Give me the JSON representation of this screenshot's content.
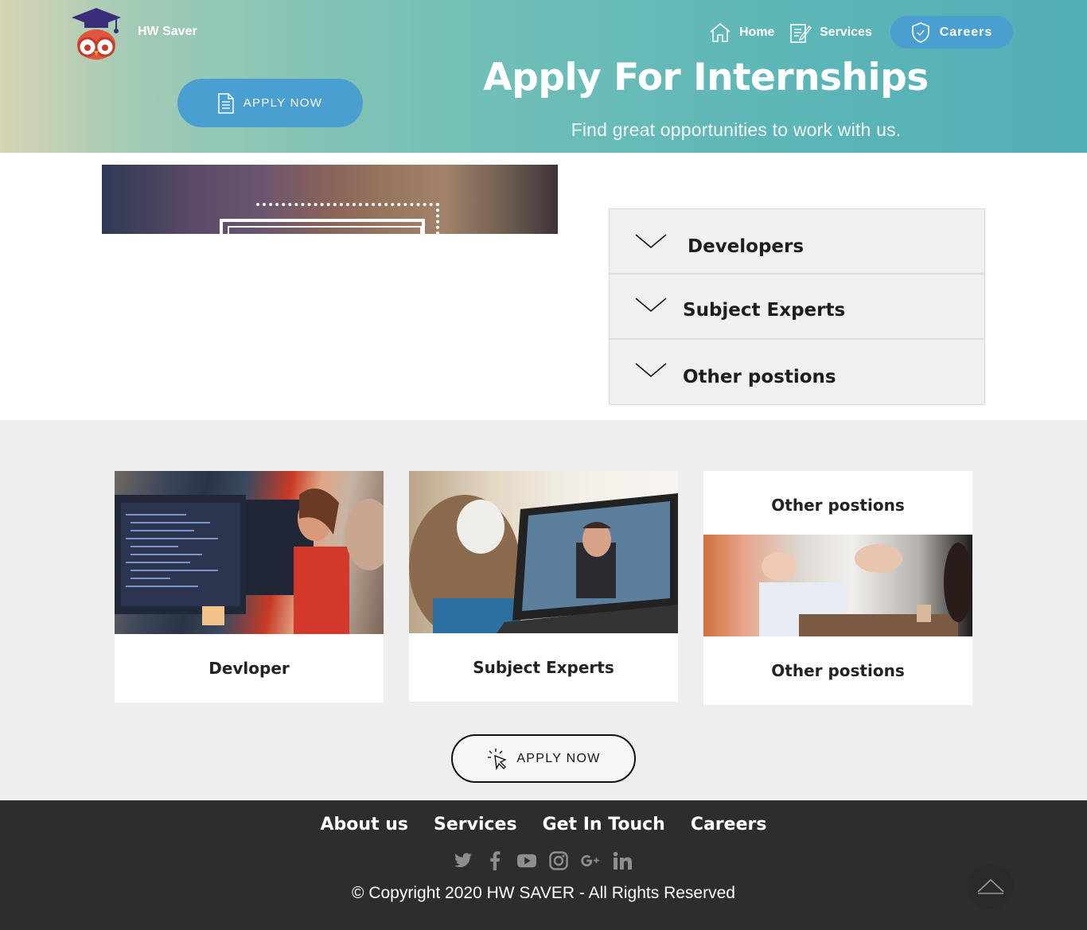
{
  "header": {
    "brand": "HW Saver",
    "nav": {
      "home": "Home",
      "services": "Services",
      "careers": "Careers"
    },
    "apply_label": "APPLY NOW",
    "title": "Apply For Internships",
    "subtitle": "Find great opportunities to work with us."
  },
  "accordion": {
    "items": [
      {
        "label": "Developers",
        "icon": "chevron-down-icon"
      },
      {
        "label": "Subject Experts",
        "icon": "chevron-down-icon"
      },
      {
        "label": "Other postions",
        "icon": "chevron-down-icon"
      }
    ]
  },
  "cards": [
    {
      "label": "Devloper"
    },
    {
      "label": "Subject Experts"
    },
    {
      "top_label": "Other postions",
      "label": "Other postions"
    }
  ],
  "cta": {
    "label": "APPLY NOW"
  },
  "footer": {
    "links": [
      "About us",
      "Services",
      "Get In Touch",
      "Careers"
    ],
    "social": [
      "twitter-icon",
      "facebook-icon",
      "youtube-icon",
      "instagram-icon",
      "google-plus-icon",
      "linkedin-icon"
    ],
    "copyright": "© Copyright 2020 HW SAVER - All Rights Reserved"
  },
  "colors": {
    "accent": "#4a9fd1",
    "hero_gradient_start": "#d8d3b4",
    "hero_gradient_end": "#52afb6",
    "footer_bg": "#2d2d2d",
    "section_bg": "#eeeeee"
  }
}
